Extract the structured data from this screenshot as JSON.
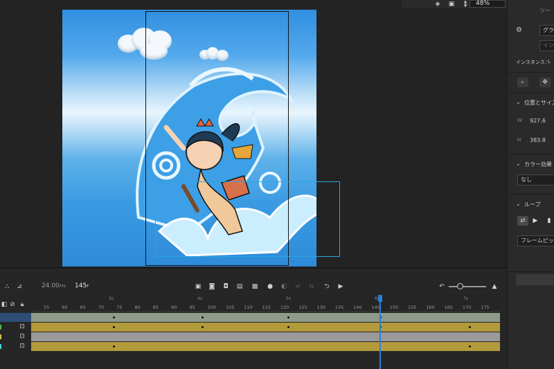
{
  "toolbar_top": {
    "zoom": "48%",
    "icons": [
      "paint-bucket-icon",
      "clip-stage-icon",
      "zoom-stepper-icon"
    ]
  },
  "right_panel": {
    "tool_label": "ツー",
    "symbol_type": "グラフ",
    "instance_name_placeholder": "インスタ",
    "instance_label": "インスタンス：",
    "instance_value": "L",
    "position_size": {
      "title": "位置とサイズ",
      "w_label": "W",
      "w_value": "927.6",
      "h_label": "H",
      "h_value": "383.8"
    },
    "color_effect": {
      "title": "カラー効果",
      "value": "なし"
    },
    "loop": {
      "title": "ループ",
      "dropdown": "フレームピッカ"
    }
  },
  "timeline": {
    "fps": "24.00",
    "fps_unit": "FPS",
    "frame": "145",
    "frame_unit": "F",
    "ruler_ticks": [
      "55",
      "60",
      "65",
      "70",
      "75",
      "80",
      "85",
      "90",
      "95",
      "100",
      "105",
      "110",
      "115",
      "120",
      "125",
      "130",
      "135",
      "140",
      "145",
      "150",
      "155",
      "160",
      "165",
      "170",
      "175"
    ],
    "second_marks": [
      "3s",
      "4s",
      "5s",
      "6s",
      "7s"
    ],
    "layer_colors": [
      "#8e9a8a",
      "#b39a3a",
      "#9a9a9a",
      "#b39a3a"
    ],
    "accent": "#2d7fd3"
  }
}
